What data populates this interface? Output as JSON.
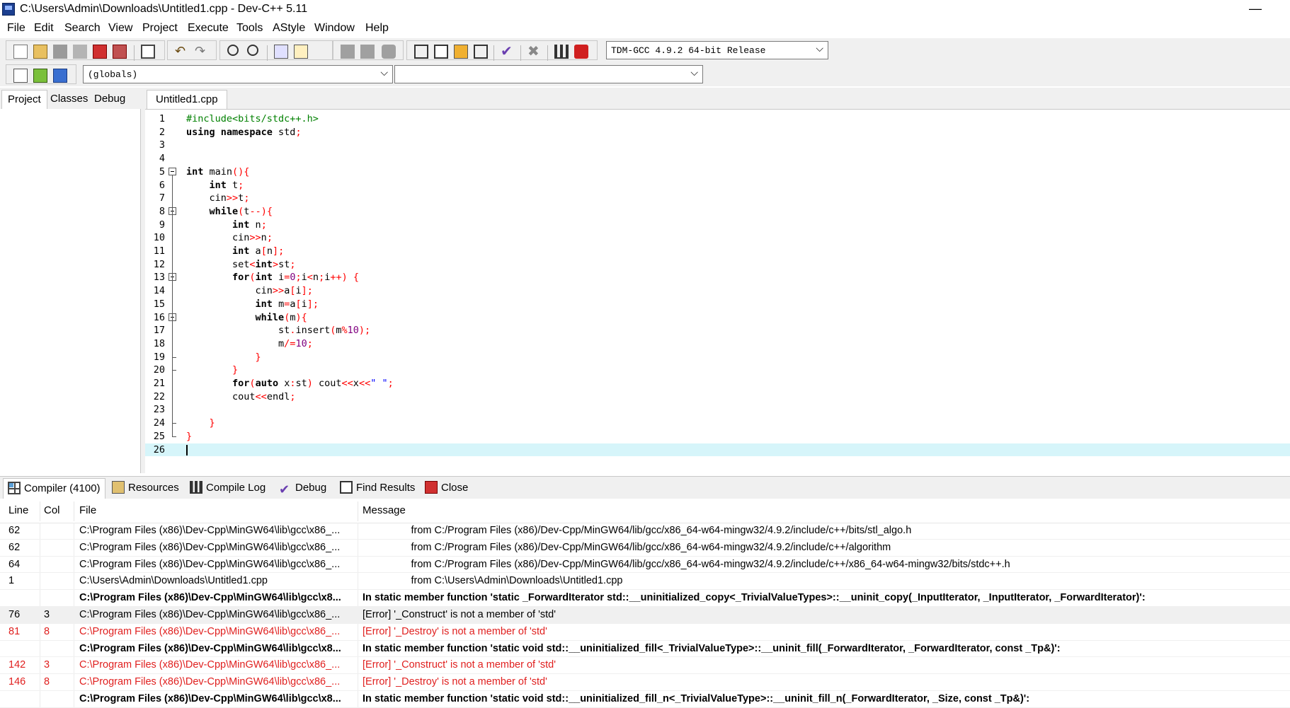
{
  "window": {
    "title": "C:\\Users\\Admin\\Downloads\\Untitled1.cpp - Dev-C++ 5.11",
    "minimize_glyph": "—"
  },
  "menu": [
    "File",
    "Edit",
    "Search",
    "View",
    "Project",
    "Execute",
    "Tools",
    "AStyle",
    "Window",
    "Help"
  ],
  "toolbar": {
    "compiler_select": "TDM-GCC 4.9.2 64-bit Release",
    "scope_select": "(globals)",
    "function_select": "",
    "dropdown_arrow": "⌵"
  },
  "left_panel": {
    "tabs": [
      "Project",
      "Classes",
      "Debug"
    ],
    "active_tab": "Project"
  },
  "editor": {
    "tab": "Untitled1.cpp",
    "lines": [
      [
        [
          "pp",
          "#include<bits/stdc++.h>"
        ]
      ],
      [
        [
          "kw",
          "using namespace "
        ],
        [
          "n",
          "std"
        ],
        [
          "sym",
          ";"
        ]
      ],
      [],
      [],
      [
        [
          "kw",
          "int "
        ],
        [
          "n",
          "main"
        ],
        [
          "sym",
          "(){"
        ]
      ],
      [
        [
          "n",
          "    "
        ],
        [
          "kw",
          "int "
        ],
        [
          "n",
          "t"
        ],
        [
          "sym",
          ";"
        ]
      ],
      [
        [
          "n",
          "    cin"
        ],
        [
          "sym",
          ">>"
        ],
        [
          "n",
          "t"
        ],
        [
          "sym",
          ";"
        ]
      ],
      [
        [
          "n",
          "    "
        ],
        [
          "kw",
          "while"
        ],
        [
          "sym",
          "("
        ],
        [
          "n",
          "t"
        ],
        [
          "sym",
          "--){"
        ]
      ],
      [
        [
          "n",
          "        "
        ],
        [
          "kw",
          "int "
        ],
        [
          "n",
          "n"
        ],
        [
          "sym",
          ";"
        ]
      ],
      [
        [
          "n",
          "        cin"
        ],
        [
          "sym",
          ">>"
        ],
        [
          "n",
          "n"
        ],
        [
          "sym",
          ";"
        ]
      ],
      [
        [
          "n",
          "        "
        ],
        [
          "kw",
          "int "
        ],
        [
          "n",
          "a"
        ],
        [
          "sym",
          "["
        ],
        [
          "n",
          "n"
        ],
        [
          "sym",
          "];"
        ]
      ],
      [
        [
          "n",
          "        set"
        ],
        [
          "sym",
          "<"
        ],
        [
          "kw",
          "int"
        ],
        [
          "sym",
          ">"
        ],
        [
          "n",
          "st"
        ],
        [
          "sym",
          ";"
        ]
      ],
      [
        [
          "n",
          "        "
        ],
        [
          "kw",
          "for"
        ],
        [
          "sym",
          "("
        ],
        [
          "kw",
          "int "
        ],
        [
          "n",
          "i"
        ],
        [
          "sym",
          "="
        ],
        [
          "num",
          "0"
        ],
        [
          "sym",
          ";"
        ],
        [
          "n",
          "i"
        ],
        [
          "sym",
          "<"
        ],
        [
          "n",
          "n"
        ],
        [
          "sym",
          ";"
        ],
        [
          "n",
          "i"
        ],
        [
          "sym",
          "++) {"
        ]
      ],
      [
        [
          "n",
          "            cin"
        ],
        [
          "sym",
          ">>"
        ],
        [
          "n",
          "a"
        ],
        [
          "sym",
          "["
        ],
        [
          "n",
          "i"
        ],
        [
          "sym",
          "];"
        ]
      ],
      [
        [
          "n",
          "            "
        ],
        [
          "kw",
          "int "
        ],
        [
          "n",
          "m"
        ],
        [
          "sym",
          "="
        ],
        [
          "n",
          "a"
        ],
        [
          "sym",
          "["
        ],
        [
          "n",
          "i"
        ],
        [
          "sym",
          "];"
        ]
      ],
      [
        [
          "n",
          "            "
        ],
        [
          "kw",
          "while"
        ],
        [
          "sym",
          "("
        ],
        [
          "n",
          "m"
        ],
        [
          "sym",
          "){"
        ]
      ],
      [
        [
          "n",
          "                st"
        ],
        [
          "sym",
          "."
        ],
        [
          "n",
          "insert"
        ],
        [
          "sym",
          "("
        ],
        [
          "n",
          "m"
        ],
        [
          "sym",
          "%"
        ],
        [
          "num",
          "10"
        ],
        [
          "sym",
          ");"
        ]
      ],
      [
        [
          "n",
          "                m"
        ],
        [
          "sym",
          "/="
        ],
        [
          "num",
          "10"
        ],
        [
          "sym",
          ";"
        ]
      ],
      [
        [
          "n",
          "            "
        ],
        [
          "sym",
          "}"
        ]
      ],
      [
        [
          "n",
          "        "
        ],
        [
          "sym",
          "}"
        ]
      ],
      [
        [
          "n",
          "        "
        ],
        [
          "kw",
          "for"
        ],
        [
          "sym",
          "("
        ],
        [
          "kw",
          "auto "
        ],
        [
          "n",
          "x"
        ],
        [
          "sym",
          ":"
        ],
        [
          "n",
          "st"
        ],
        [
          "sym",
          ") "
        ],
        [
          "n",
          "cout"
        ],
        [
          "sym",
          "<<"
        ],
        [
          "n",
          "x"
        ],
        [
          "sym",
          "<<"
        ],
        [
          "str",
          "\" \""
        ],
        [
          "sym",
          ";"
        ]
      ],
      [
        [
          "n",
          "        cout"
        ],
        [
          "sym",
          "<<"
        ],
        [
          "n",
          "endl"
        ],
        [
          "sym",
          ";"
        ]
      ],
      [],
      [
        [
          "n",
          "    "
        ],
        [
          "sym",
          "}"
        ]
      ],
      [
        [
          "sym",
          "}"
        ]
      ],
      []
    ],
    "current_line": 26
  },
  "bottom_tabs": [
    {
      "label": "Compiler (4100)",
      "icon": "compiler-grid-icon"
    },
    {
      "label": "Resources",
      "icon": "resources-icon"
    },
    {
      "label": "Compile Log",
      "icon": "bar-chart-icon"
    },
    {
      "label": "Debug",
      "icon": "check-icon"
    },
    {
      "label": "Find Results",
      "icon": "find-icon"
    },
    {
      "label": "Close",
      "icon": "close-red-icon"
    }
  ],
  "messages": {
    "columns": [
      "Line",
      "Col",
      "File",
      "Message"
    ],
    "rows": [
      {
        "line": "62",
        "col": "",
        "file": "C:\\Program Files (x86)\\Dev-Cpp\\MinGW64\\lib\\gcc\\x86_...",
        "message": "                 from C:/Program Files (x86)/Dev-Cpp/MinGW64/lib/gcc/x86_64-w64-mingw32/4.9.2/include/c++/bits/stl_algo.h",
        "style": "normal"
      },
      {
        "line": "62",
        "col": "",
        "file": "C:\\Program Files (x86)\\Dev-Cpp\\MinGW64\\lib\\gcc\\x86_...",
        "message": "                 from C:/Program Files (x86)/Dev-Cpp/MinGW64/lib/gcc/x86_64-w64-mingw32/4.9.2/include/c++/algorithm",
        "style": "normal"
      },
      {
        "line": "64",
        "col": "",
        "file": "C:\\Program Files (x86)\\Dev-Cpp\\MinGW64\\lib\\gcc\\x86_...",
        "message": "                 from C:/Program Files (x86)/Dev-Cpp/MinGW64/lib/gcc/x86_64-w64-mingw32/4.9.2/include/c++/x86_64-w64-mingw32/bits/stdc++.h",
        "style": "normal"
      },
      {
        "line": "1",
        "col": "",
        "file": "C:\\Users\\Admin\\Downloads\\Untitled1.cpp",
        "message": "                 from C:\\Users\\Admin\\Downloads\\Untitled1.cpp",
        "style": "normal"
      },
      {
        "line": "",
        "col": "",
        "file": "C:\\Program Files (x86)\\Dev-Cpp\\MinGW64\\lib\\gcc\\x8...",
        "message": "In static member function 'static _ForwardIterator std::__uninitialized_copy<_TrivialValueTypes>::__uninit_copy(_InputIterator, _InputIterator, _ForwardIterator)':",
        "style": "bold"
      },
      {
        "line": "76",
        "col": "3",
        "file": "C:\\Program Files (x86)\\Dev-Cpp\\MinGW64\\lib\\gcc\\x86_...",
        "message": "[Error] '_Construct' is not a member of 'std'",
        "style": "selected"
      },
      {
        "line": "81",
        "col": "8",
        "file": "C:\\Program Files (x86)\\Dev-Cpp\\MinGW64\\lib\\gcc\\x86_...",
        "message": "[Error] '_Destroy' is not a member of 'std'",
        "style": "red"
      },
      {
        "line": "",
        "col": "",
        "file": "C:\\Program Files (x86)\\Dev-Cpp\\MinGW64\\lib\\gcc\\x8...",
        "message": "In static member function 'static void std::__uninitialized_fill<_TrivialValueType>::__uninit_fill(_ForwardIterator, _ForwardIterator, const _Tp&)':",
        "style": "bold"
      },
      {
        "line": "142",
        "col": "3",
        "file": "C:\\Program Files (x86)\\Dev-Cpp\\MinGW64\\lib\\gcc\\x86_...",
        "message": "[Error] '_Construct' is not a member of 'std'",
        "style": "red"
      },
      {
        "line": "146",
        "col": "8",
        "file": "C:\\Program Files (x86)\\Dev-Cpp\\MinGW64\\lib\\gcc\\x86_...",
        "message": "[Error] '_Destroy' is not a member of 'std'",
        "style": "red"
      },
      {
        "line": "",
        "col": "",
        "file": "C:\\Program Files (x86)\\Dev-Cpp\\MinGW64\\lib\\gcc\\x8...",
        "message": "In static member function 'static void std::__uninitialized_fill_n<_TrivialValueType>::__uninit_fill_n(_ForwardIterator, _Size, const _Tp&)':",
        "style": "bold"
      }
    ]
  },
  "colors": {
    "error_red": "#e0201f",
    "current_line": "#d6f5fa",
    "keyword_symbol": "#ff0000",
    "number": "#800080",
    "preprocessor": "#008000",
    "string": "#0000ff"
  }
}
